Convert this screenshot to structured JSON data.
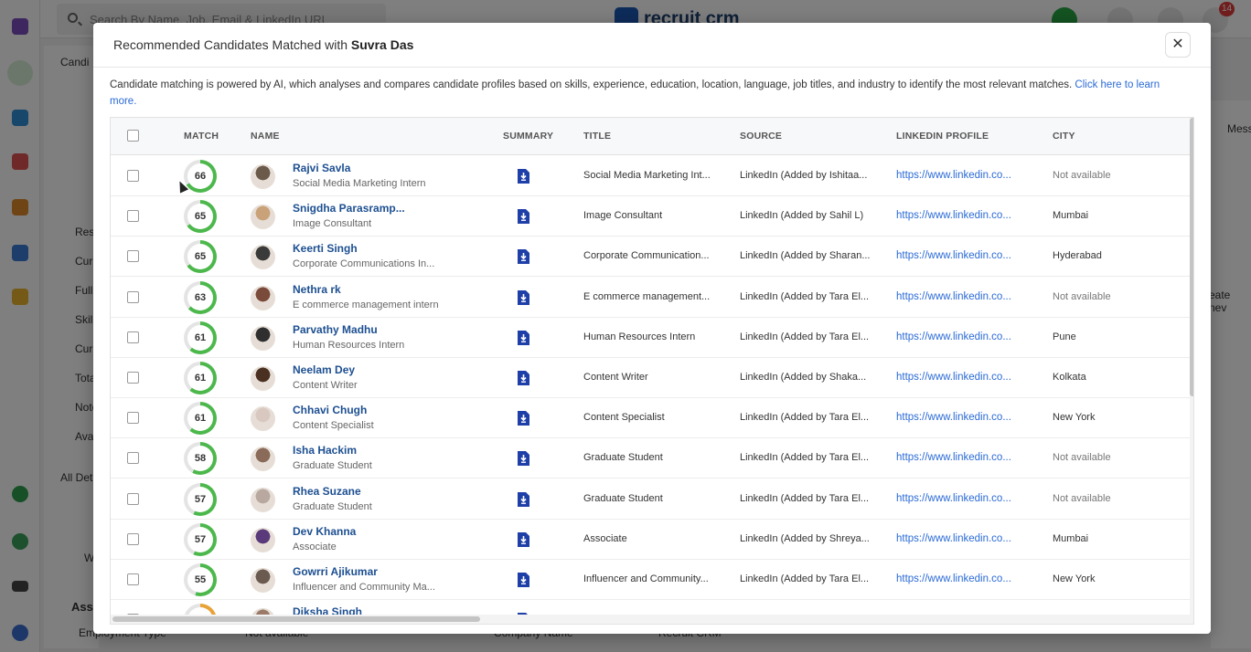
{
  "background": {
    "search_placeholder": "Search By Name, Job, Email & LinkedIn URL",
    "logo_text": "recruit crm",
    "notification_count": "14",
    "left_texts": [
      "Candi",
      "Res",
      "Curr",
      "Full",
      "Skil",
      "Curr",
      "Tota",
      "Note",
      "Ava",
      "All Deta",
      "W",
      "Asse",
      "Employment Type"
    ],
    "right_texts": [
      "Mess",
      "eate nev"
    ],
    "bottom_texts": [
      "Not available",
      "Company Name",
      "Recruit CRM"
    ]
  },
  "modal": {
    "title_prefix": "Recommended Candidates Matched with",
    "title_name": "Suvra Das",
    "close_label": "✕",
    "description": "Candidate matching is powered by AI, which analyses and compares candidate profiles based on skills, experience, education, location, language, job titles, and industry to identify the most relevant matches. ",
    "learn_more": "Click here to learn more."
  },
  "table": {
    "columns": {
      "match": "MATCH",
      "name": "NAME",
      "summary": "SUMMARY",
      "title": "TITLE",
      "source": "SOURCE",
      "linkedin": "LINKEDIN PROFILE",
      "city": "CITY"
    },
    "rows": [
      {
        "match": "66",
        "name": "Rajvi Savla",
        "headline": "Social Media Marketing Intern",
        "title": "Social Media Marketing Int...",
        "source": "LinkedIn (Added by Ishitaa...",
        "linkedin": "https://www.linkedin.co...",
        "city": "Not available"
      },
      {
        "match": "65",
        "name": "Snigdha Parasramp...",
        "headline": "Image Consultant",
        "title": "Image Consultant",
        "source": "LinkedIn (Added by Sahil L)",
        "linkedin": "https://www.linkedin.co...",
        "city": "Mumbai"
      },
      {
        "match": "65",
        "name": "Keerti Singh",
        "headline": "Corporate Communications In...",
        "title": "Corporate Communication...",
        "source": "LinkedIn (Added by Sharan...",
        "linkedin": "https://www.linkedin.co...",
        "city": "Hyderabad"
      },
      {
        "match": "63",
        "name": "Nethra rk",
        "headline": "E commerce management intern",
        "title": "E commerce management...",
        "source": "LinkedIn (Added by Tara El...",
        "linkedin": "https://www.linkedin.co...",
        "city": "Not available"
      },
      {
        "match": "61",
        "name": "Parvathy Madhu",
        "headline": "Human Resources Intern",
        "title": "Human Resources Intern",
        "source": "LinkedIn (Added by Tara El...",
        "linkedin": "https://www.linkedin.co...",
        "city": "Pune"
      },
      {
        "match": "61",
        "name": "Neelam Dey",
        "headline": "Content Writer",
        "title": "Content Writer",
        "source": "LinkedIn (Added by Shaka...",
        "linkedin": "https://www.linkedin.co...",
        "city": "Kolkata"
      },
      {
        "match": "61",
        "name": "Chhavi Chugh",
        "headline": "Content Specialist",
        "title": "Content Specialist",
        "source": "LinkedIn (Added by Tara El...",
        "linkedin": "https://www.linkedin.co...",
        "city": "New York"
      },
      {
        "match": "58",
        "name": "Isha Hackim",
        "headline": "Graduate Student",
        "title": "Graduate Student",
        "source": "LinkedIn (Added by Tara El...",
        "linkedin": "https://www.linkedin.co...",
        "city": "Not available"
      },
      {
        "match": "57",
        "name": "Rhea Suzane",
        "headline": "Graduate Student",
        "title": "Graduate Student",
        "source": "LinkedIn (Added by Tara El...",
        "linkedin": "https://www.linkedin.co...",
        "city": "Not available"
      },
      {
        "match": "57",
        "name": "Dev Khanna",
        "headline": "Associate",
        "title": "Associate",
        "source": "LinkedIn (Added by Shreya...",
        "linkedin": "https://www.linkedin.co...",
        "city": "Mumbai"
      },
      {
        "match": "55",
        "name": "Gowrri Ajikumar",
        "headline": "Influencer and Community Ma...",
        "title": "Influencer and Community...",
        "source": "LinkedIn (Added by Tara El...",
        "linkedin": "https://www.linkedin.co...",
        "city": "New York"
      },
      {
        "match": "",
        "name": "Diksha Singh",
        "headline": "",
        "title": "",
        "source": "",
        "linkedin": "",
        "city": ""
      }
    ]
  },
  "colors": {
    "match_ring": "#4cb84c",
    "match_ring_low": "#e8a23a",
    "ring_track": "#e4e4e4",
    "link": "#2a6ad6",
    "name": "#1d4f91",
    "summary_icon": "#1f3fa8",
    "muted_city": "#777777"
  },
  "icons": {
    "summary": "document-download-icon",
    "close": "close-icon"
  }
}
